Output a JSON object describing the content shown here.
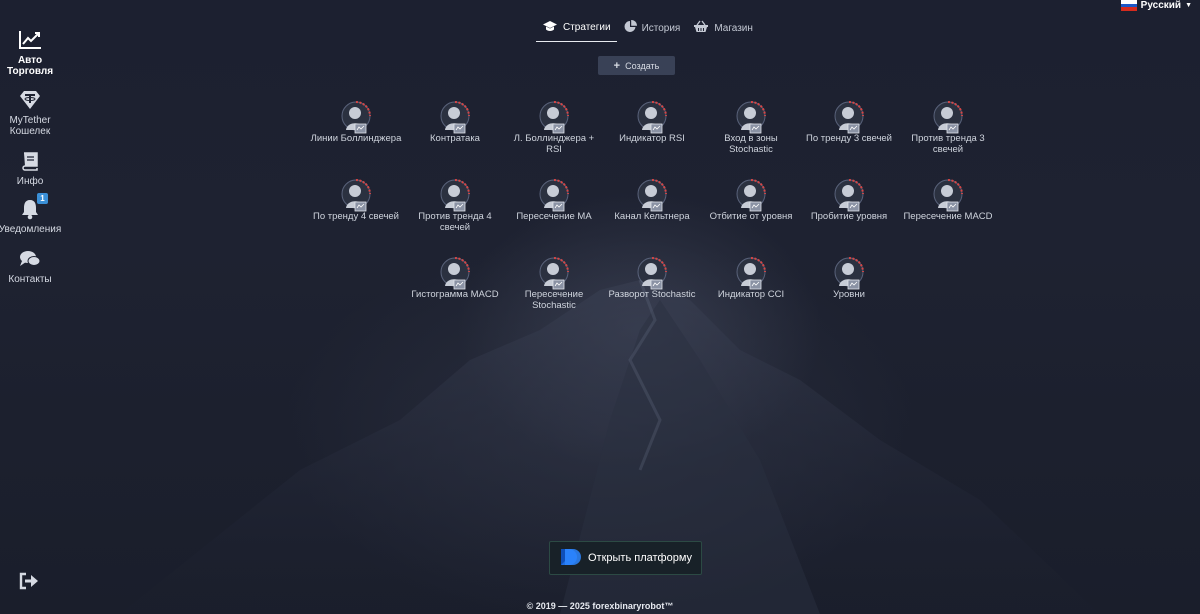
{
  "language": {
    "label": "Русский",
    "flag_colors": [
      "#ffffff",
      "#1c57c6",
      "#d52b1e"
    ]
  },
  "sidebar": {
    "items": [
      {
        "label": "Авто Торговля",
        "icon": "chart-line-icon",
        "active": true
      },
      {
        "label": "MyTether Кошелек",
        "icon": "tether-icon",
        "active": false
      },
      {
        "label": "Инфо",
        "icon": "book-icon",
        "active": false
      },
      {
        "label": "Уведомления",
        "icon": "bell-icon",
        "active": false,
        "badge": "1"
      },
      {
        "label": "Контакты",
        "icon": "chat-icon",
        "active": false
      }
    ],
    "logout_icon": "logout-icon"
  },
  "tabs": [
    {
      "label": "Стратегии",
      "icon": "graduation-cap-icon",
      "active": true
    },
    {
      "label": "История",
      "icon": "pie-chart-icon",
      "active": false
    },
    {
      "label": "Магазин",
      "icon": "basket-icon",
      "active": false
    }
  ],
  "create_button": {
    "label": "Создать",
    "icon": "plus-icon"
  },
  "strategies": [
    {
      "name": "Линии Боллинджера"
    },
    {
      "name": "Контратака"
    },
    {
      "name": "Л. Боллинджера + RSI"
    },
    {
      "name": "Индикатор RSI"
    },
    {
      "name": "Вход в зоны Stochastic"
    },
    {
      "name": "По тренду 3 свечей"
    },
    {
      "name": "Против тренда 3 свечей"
    },
    {
      "name": "По тренду 4 свечей"
    },
    {
      "name": "Против тренда 4 свечей"
    },
    {
      "name": "Пересечение MA"
    },
    {
      "name": "Канал Кельтнера"
    },
    {
      "name": "Отбитие от уровня"
    },
    {
      "name": "Пробитие уровня"
    },
    {
      "name": "Пересечение MACD"
    },
    {
      "name": "Гистограмма MACD"
    },
    {
      "name": "Пересечение Stochastic"
    },
    {
      "name": "Разворот Stochastic"
    },
    {
      "name": "Индикатор CCI"
    },
    {
      "name": "Уровни"
    }
  ],
  "platform_button": {
    "label": "Открыть платформу",
    "icon": "platform-logo-icon",
    "accent": "#1f6fe5"
  },
  "footer": {
    "text": "© 2019 — 2025 forexbinaryrobot™"
  },
  "colors": {
    "background": "#1e2231",
    "accent_blue": "#3a8fd6",
    "avatar_red": "#d64545"
  }
}
